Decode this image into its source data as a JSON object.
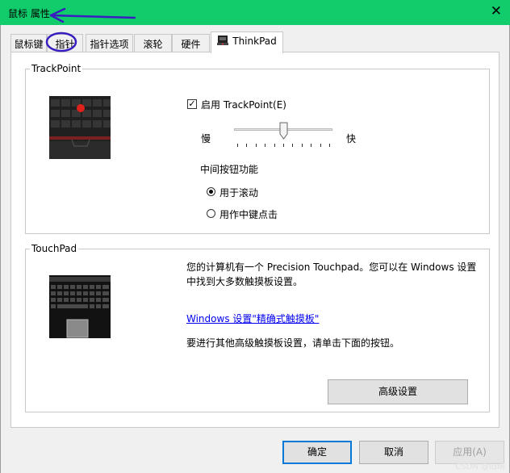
{
  "window": {
    "title": "鼠标 属性"
  },
  "tabs": [
    {
      "label": "鼠标键"
    },
    {
      "label": "指针"
    },
    {
      "label": "指针选项"
    },
    {
      "label": "滚轮"
    },
    {
      "label": "硬件"
    },
    {
      "label": "ThinkPad"
    }
  ],
  "trackpoint": {
    "group_title": "TrackPoint",
    "enable_label": "启用 TrackPoint(E)",
    "enable_checked": true,
    "slow_label": "慢",
    "fast_label": "快",
    "speed_fraction": 0.5,
    "middle_button_title": "中间按钮功能",
    "options": [
      {
        "label": "用于滚动",
        "selected": true
      },
      {
        "label": "用作中键点击",
        "selected": false
      }
    ]
  },
  "touchpad": {
    "group_title": "TouchPad",
    "description_line1": "您的计算机有一个 Precision Touchpad。您可以在 Windows 设置",
    "description_line2": "中找到大多数触摸板设置。",
    "settings_link": "Windows 设置\"精确式触摸板\"",
    "advanced_hint": "要进行其他高级触摸板设置，请单击下面的按钮。",
    "advanced_button": "高级设置"
  },
  "buttons": {
    "ok": "确定",
    "cancel": "取消",
    "apply": "应用(A)"
  },
  "watermark": "CSDN @旧瑞",
  "colors": {
    "titlebar": "#10cc6a",
    "link": "#0000ee",
    "annotation": "#3a1dbf",
    "default_button_border": "#0078d7"
  }
}
